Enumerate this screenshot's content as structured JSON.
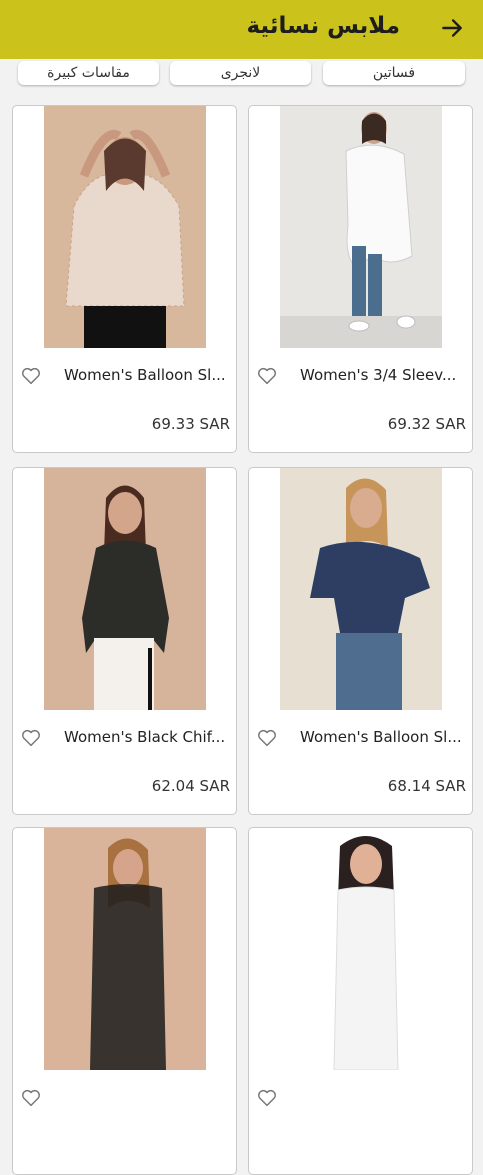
{
  "header": {
    "title": "ملابس نسائية",
    "back_icon": "arrow-right-icon",
    "bg_color": "#cbc21c"
  },
  "categories": [
    {
      "label": "فساتين"
    },
    {
      "label": "لانجرى"
    },
    {
      "label": "مقاسات كبيرة"
    }
  ],
  "products": [
    {
      "name": "Women's Balloon Sl...",
      "price": "69.33 SAR"
    },
    {
      "name": "Women's 3/4 Sleev...",
      "price": "69.32 SAR"
    },
    {
      "name": "Women's Black Chif...",
      "price": "62.04 SAR"
    },
    {
      "name": "Women's Balloon Sl...",
      "price": "68.14 SAR"
    },
    {
      "name": "",
      "price": ""
    },
    {
      "name": "",
      "price": ""
    }
  ]
}
